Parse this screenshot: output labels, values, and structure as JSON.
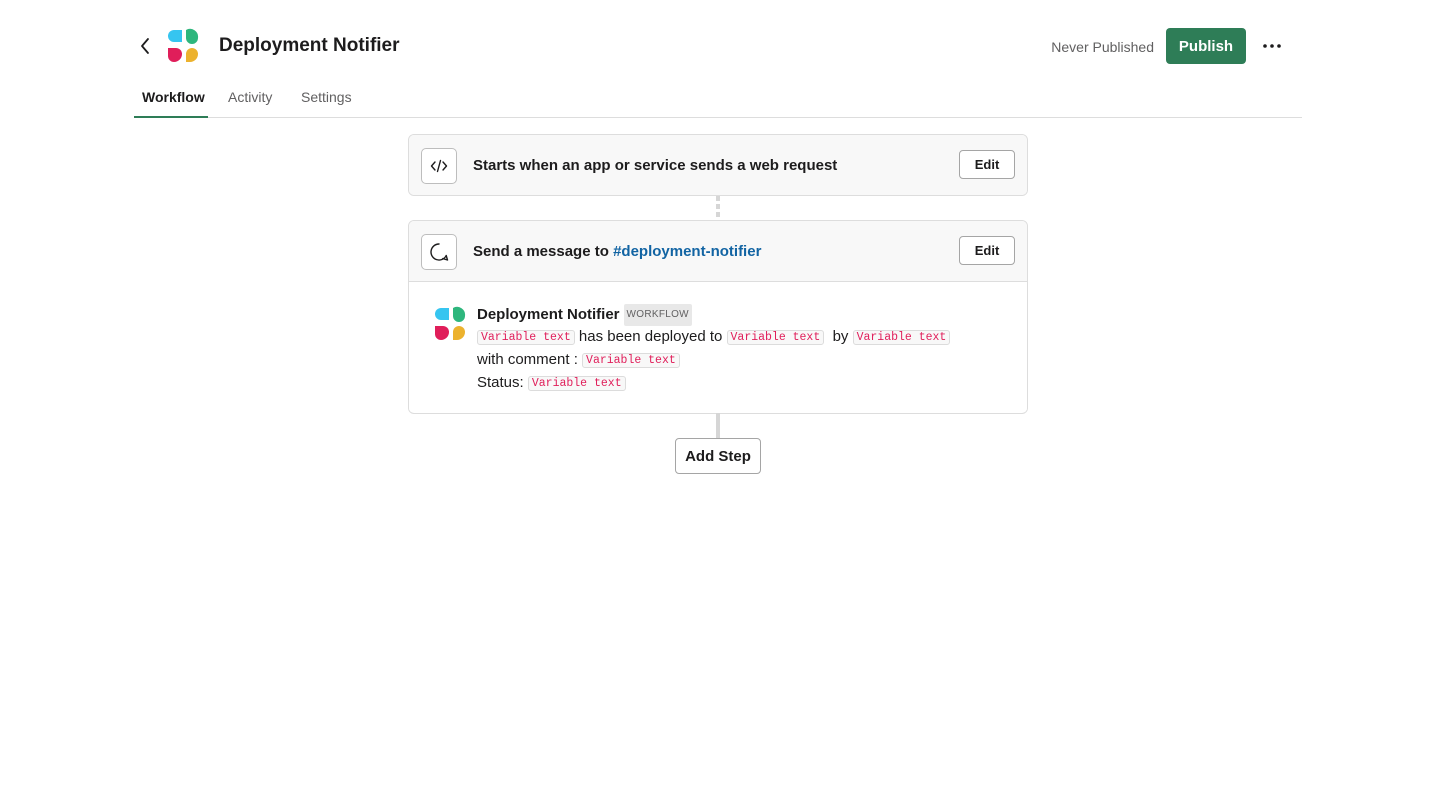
{
  "header": {
    "title": "Deployment Notifier",
    "publish_status": "Never Published",
    "publish_label": "Publish",
    "logo_colors": [
      "#36c5f0",
      "#2eb67d",
      "#e01e5a",
      "#ecb22e"
    ],
    "accent_color": "#2e7d57"
  },
  "tabs": [
    {
      "label": "Workflow",
      "active": true
    },
    {
      "label": "Activity",
      "active": false
    },
    {
      "label": "Settings",
      "active": false
    }
  ],
  "steps": [
    {
      "icon": "code-icon",
      "title": "Starts when an app or service sends a web request",
      "edit_label": "Edit"
    },
    {
      "icon": "message-bubble-icon",
      "title_prefix": "Send a message to",
      "channel": "#deployment-notifier",
      "edit_label": "Edit",
      "preview": {
        "author": "Deployment Notifier",
        "badge": "WORKFLOW",
        "variable_label": "Variable text",
        "line1_mid": "has been deployed to",
        "line1_by": "by",
        "line2_prefix": "with comment :",
        "line3_prefix": "Status:"
      }
    }
  ],
  "add_step_label": "Add Step"
}
